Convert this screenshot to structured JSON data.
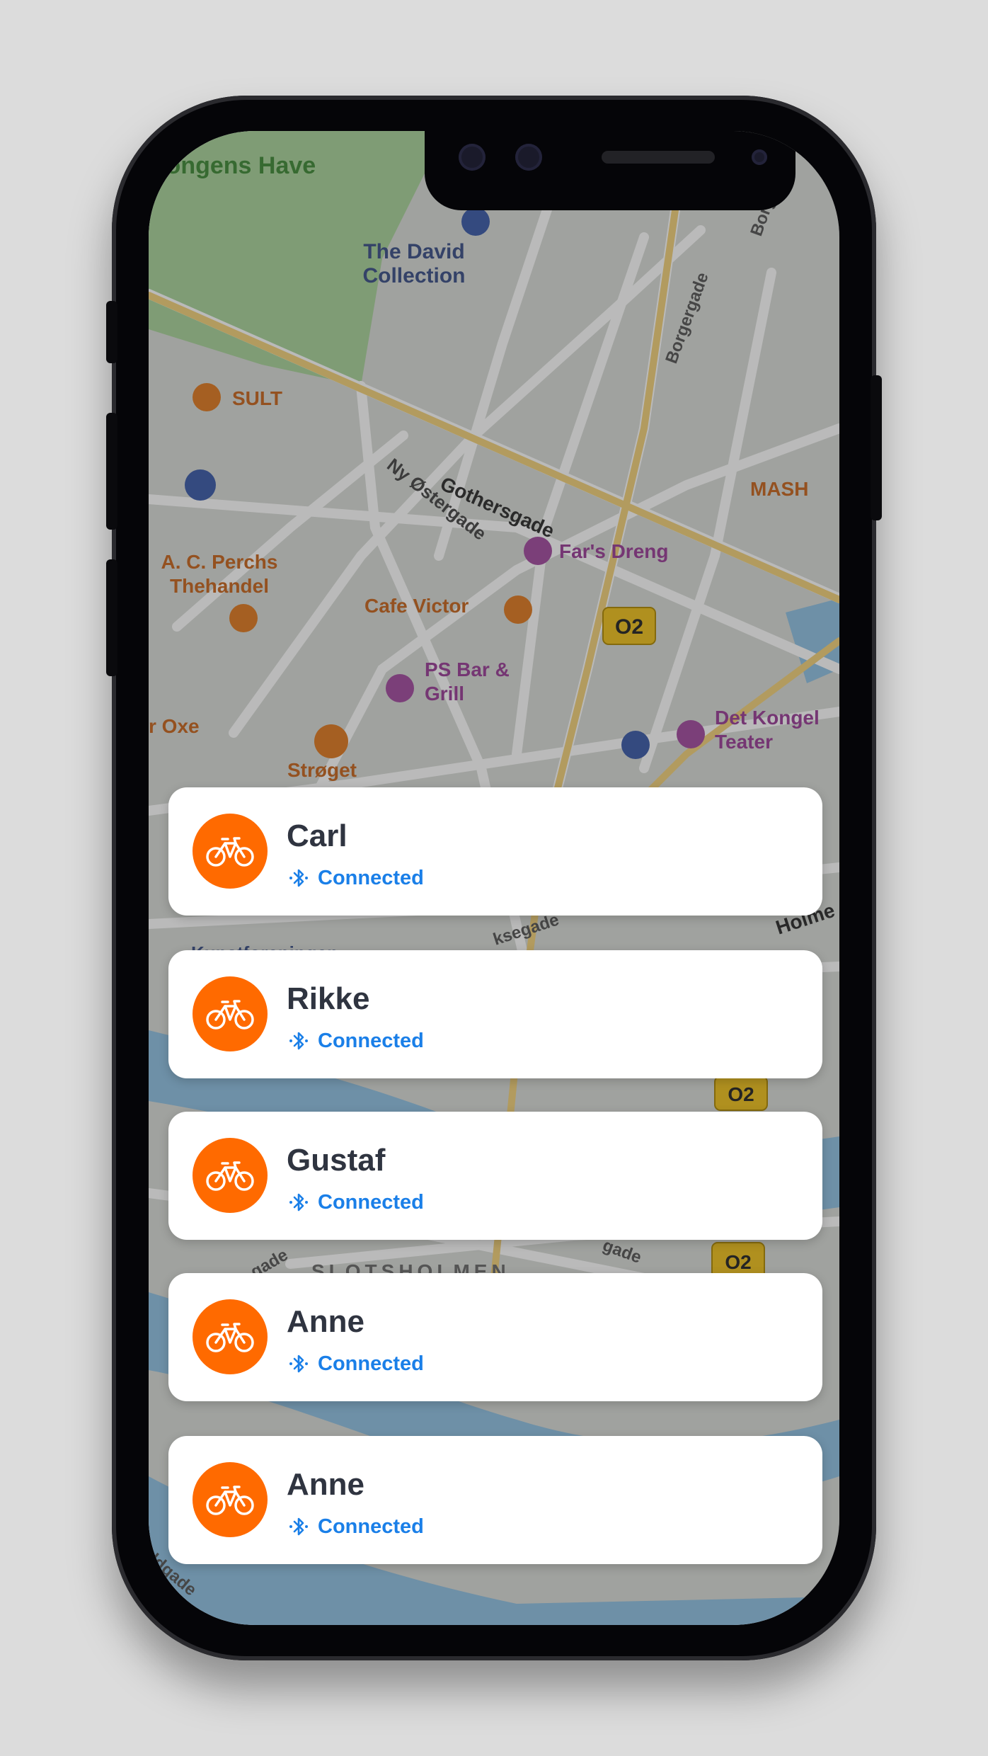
{
  "map": {
    "labels": {
      "kongens_have": "Kongens Have",
      "david_collection": [
        "The David",
        "Collection"
      ],
      "sult": "SULT",
      "gothersgade": "Gothersgade",
      "ny_ostergade": "Ny Østergade",
      "borgergade_1": "Borgergade",
      "borgergade_2": "Borgergade",
      "mash": "MASH",
      "fars_dreng": "Far's Dreng",
      "perchs": [
        "A. C. Perchs",
        "Thehandel"
      ],
      "cafe_victor": "Cafe Victor",
      "metro_1": "O2",
      "metro_2": "O2",
      "metro_3": "O2",
      "ps_bar": [
        "PS Bar &",
        "Grill"
      ],
      "oxe": "r Oxe",
      "stroget": "Strøget",
      "kongelige": [
        "Det Kongel",
        "Teater"
      ],
      "slotsholmen": "SLOTSHOLMEN",
      "kunstforeningen": "Kunstforeningen",
      "holmens": "Holme",
      "ksegade": "ksegade",
      "gade_1": "gade",
      "gade_2": "gade",
      "ldgade": "ldgade"
    }
  },
  "riders": [
    {
      "name": "Carl",
      "status": "Connected"
    },
    {
      "name": "Rikke",
      "status": "Connected"
    },
    {
      "name": "Gustaf",
      "status": "Connected"
    },
    {
      "name": "Anne",
      "status": "Connected"
    },
    {
      "name": "Anne",
      "status": "Connected"
    }
  ],
  "colors": {
    "avatar": "#ff6a00",
    "status": "#1a7fe8",
    "name": "#2f3440",
    "card": "#ffffff"
  },
  "icons": {
    "avatar": "bicycle-icon",
    "status": "bluetooth-icon"
  }
}
